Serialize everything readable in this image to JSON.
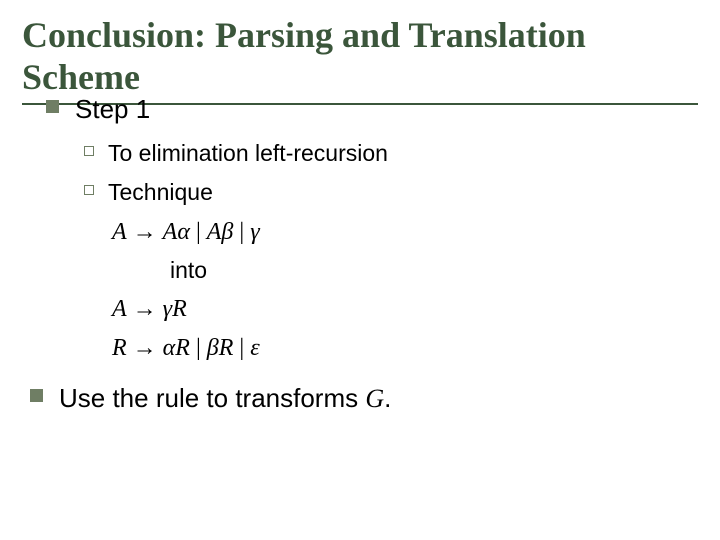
{
  "title": "Conclusion: Parsing and Translation Scheme",
  "bullets": {
    "step1": "Step 1",
    "sub1": "To elimination left-recursion",
    "sub2": "Technique",
    "into": "into",
    "final_pre": "Use the rule to transforms ",
    "final_g": "G",
    "final_post": "."
  },
  "math": {
    "line1_A": "A",
    "line1_arrow": " → ",
    "line1_Aalpha": "Aα",
    "line1_bar1": "  |  ",
    "line1_Abeta": "Aβ",
    "line1_bar2": "  | ",
    "line1_gamma": "γ",
    "line2_A": "A",
    "line2_arrow": " → ",
    "line2_gammaR": "γR",
    "line3_R": "R",
    "line3_arrow": " → ",
    "line3_alphaR": "αR",
    "line3_bar1": " | ",
    "line3_betaR": "βR",
    "line3_bar2": "  | ",
    "line3_eps": "ε"
  }
}
